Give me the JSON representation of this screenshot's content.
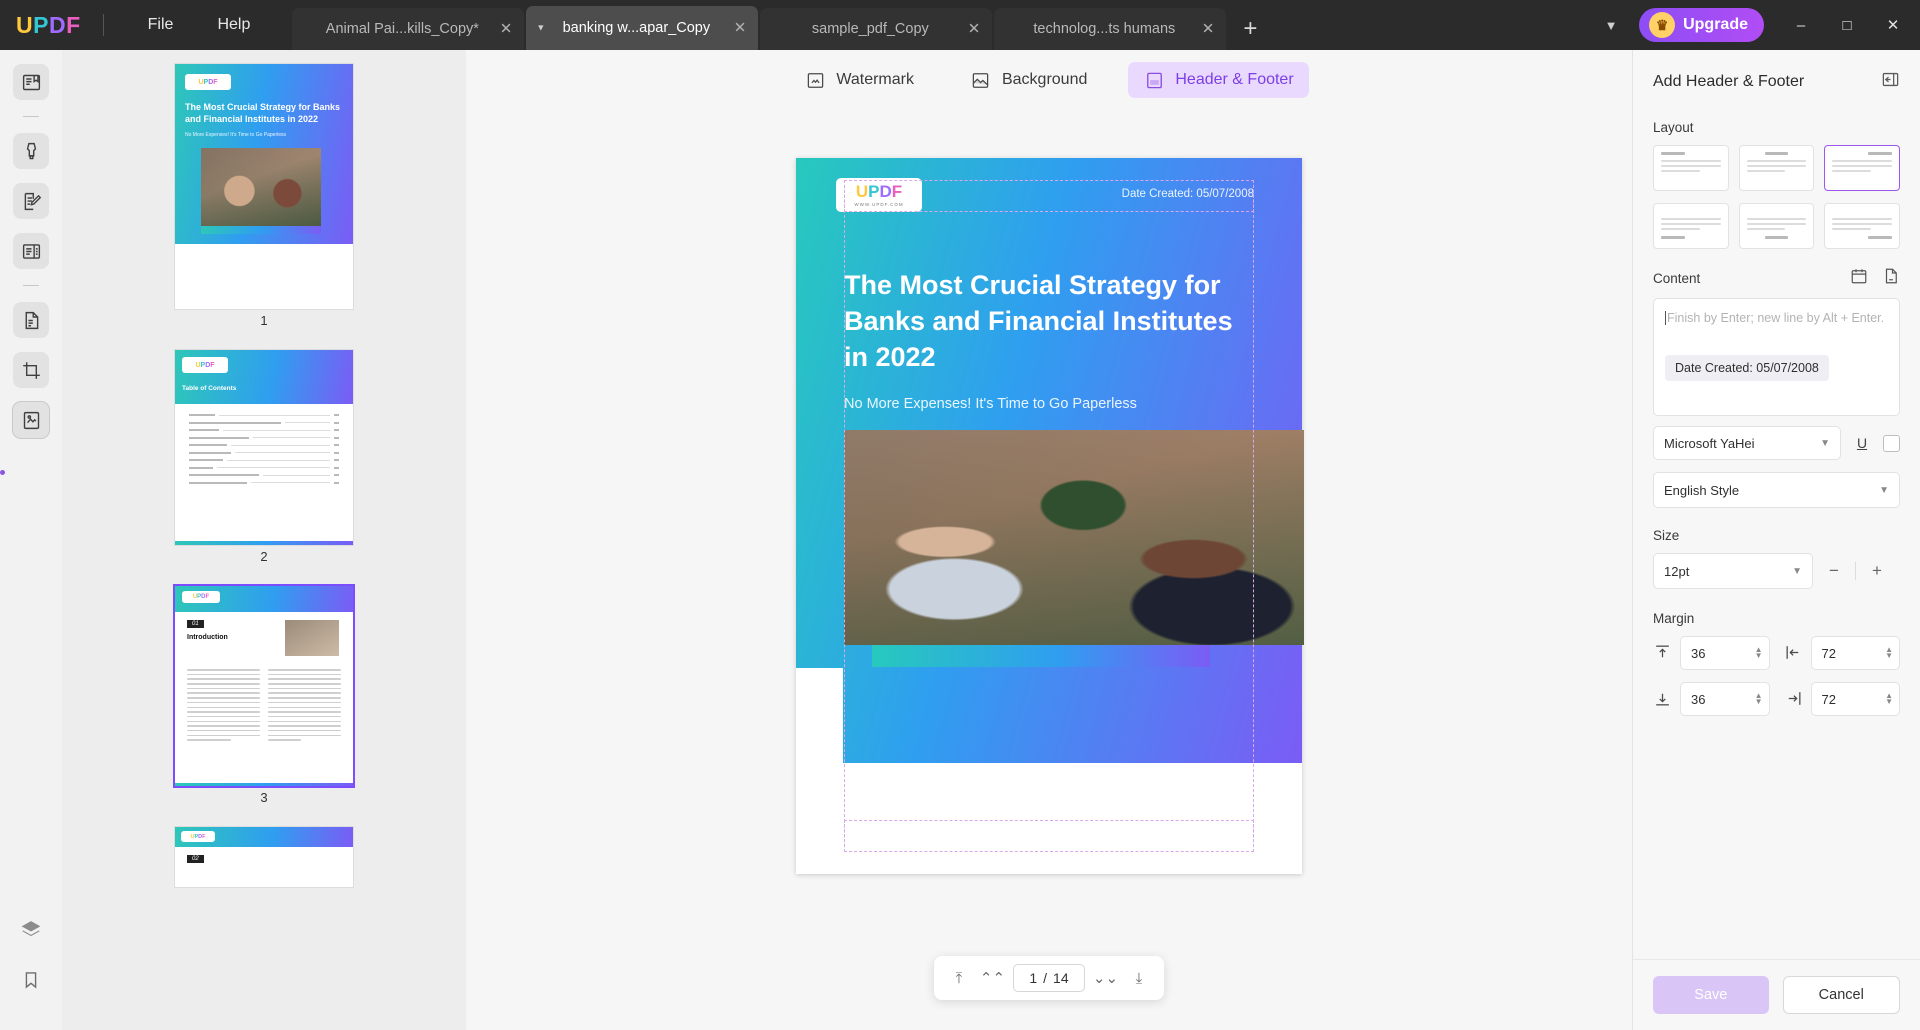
{
  "titlebar": {
    "logo": [
      "U",
      "P",
      "D",
      "F"
    ],
    "menus": [
      {
        "label": "File",
        "name": "menu-file"
      },
      {
        "label": "Help",
        "name": "menu-help"
      }
    ],
    "tabs": [
      {
        "label": "Animal Pai...kills_Copy*",
        "active": false,
        "caret": false
      },
      {
        "label": "banking w...apar_Copy",
        "active": true,
        "caret": true
      },
      {
        "label": "sample_pdf_Copy",
        "active": false,
        "caret": false
      },
      {
        "label": "technolog...ts humans",
        "active": false,
        "caret": false
      }
    ],
    "new_tab": "+",
    "tab_list_caret": "⌄",
    "upgrade_label": "Upgrade",
    "crown": "♛",
    "win_minimize": "—",
    "win_maximize": "❐",
    "win_close": "✕"
  },
  "rail": {
    "items": [
      {
        "name": "sidebar-item-reader",
        "icon": "book-icon",
        "selected": false
      },
      {
        "name": "sidebar-item-annotate",
        "icon": "marker-pen-icon",
        "selected": false
      },
      {
        "name": "sidebar-item-edit-pdf",
        "icon": "edit-document-icon",
        "selected": false
      },
      {
        "name": "sidebar-item-organize",
        "icon": "page-layout-icon",
        "selected": false
      },
      {
        "name": "sidebar-item-convert",
        "icon": "convert-file-icon",
        "selected": false
      },
      {
        "name": "sidebar-item-crop",
        "icon": "crop-icon",
        "selected": false
      },
      {
        "name": "sidebar-item-page-edit",
        "icon": "page-watermark-icon",
        "selected": true
      }
    ],
    "bottom": [
      {
        "name": "sidebar-item-layers",
        "icon": "layers-icon"
      },
      {
        "name": "sidebar-item-bookmarks",
        "icon": "bookmark-icon"
      }
    ]
  },
  "thumbnails": {
    "pages": [
      {
        "number": "1",
        "selected": false,
        "title": "The Most Crucial Strategy for Banks and Financial Institutes in 2022",
        "subtitle": "No More Expenses! It's Time to Go Paperless"
      },
      {
        "number": "2",
        "selected": false,
        "title": "Table of Contents"
      },
      {
        "number": "3",
        "selected": true,
        "badge": "01",
        "title": "Introduction"
      },
      {
        "number": "4",
        "selected": false,
        "badge": "02",
        "title": ""
      }
    ],
    "toc_entries": [
      "Introduction",
      "Increasing Risk Practices and Reducing Development Banks and Financial Firms",
      "Customer Loyalty",
      "Better Customer Servicing and Communication",
      "Electronic Signature",
      "Saving Cost and Time",
      "Enhanced Security",
      "Efficiency",
      "A Good Chance For Developing Nations",
      "Don't worry! The solution is here!"
    ]
  },
  "toolbar": {
    "items": [
      {
        "label": "Watermark",
        "icon": "watermark-icon",
        "active": false
      },
      {
        "label": "Background",
        "icon": "background-icon",
        "active": false
      },
      {
        "label": "Header & Footer",
        "icon": "header-footer-icon",
        "active": true
      }
    ]
  },
  "document": {
    "logo_text": [
      "U",
      "P",
      "D",
      "F"
    ],
    "logo_sub": "WWW.UPDF.COM",
    "date_created": "Date Created: 05/07/2008",
    "title": "The Most Crucial Strategy for Banks and Financial Institutes in 2022",
    "subtitle": "No More Expenses! It's Time to Go Paperless"
  },
  "pagebar": {
    "first": "⤒",
    "prev": "⌃⌃",
    "current": "1",
    "separator": "/",
    "total": "14",
    "next": "⌄⌄",
    "last": "⤓"
  },
  "panel": {
    "title": "Add Header & Footer",
    "expand_icon": "expand-panel-icon",
    "layout_label": "Layout",
    "layout_options": [
      {
        "name": "layout-option-1",
        "selected": false
      },
      {
        "name": "layout-option-2",
        "selected": false
      },
      {
        "name": "layout-option-3",
        "selected": true
      },
      {
        "name": "layout-option-4",
        "selected": false
      },
      {
        "name": "layout-option-5",
        "selected": false
      },
      {
        "name": "layout-option-6",
        "selected": false
      }
    ],
    "content_label": "Content",
    "content_placeholder": "Finish by Enter; new line by Alt + Enter.",
    "content_chip": "Date Created: 05/07/2008",
    "date_icon": "calendar-icon",
    "page_number_icon": "page-number-icon",
    "font_family": "Microsoft YaHei",
    "underline_label": "U",
    "color_swatch": "#ffffff",
    "style_value": "English Style",
    "size_label": "Size",
    "size_value": "12pt",
    "minus": "−",
    "plus": "+",
    "margin_label": "Margin",
    "margins": [
      {
        "name": "margin-top",
        "icon": "margin-top-icon",
        "value": "36"
      },
      {
        "name": "margin-left",
        "icon": "margin-left-icon",
        "value": "72"
      },
      {
        "name": "margin-bottom",
        "icon": "margin-bottom-icon",
        "value": "36"
      },
      {
        "name": "margin-right",
        "icon": "margin-right-icon",
        "value": "72"
      }
    ],
    "save_label": "Save",
    "cancel_label": "Cancel"
  },
  "colors": {
    "accent": "#7b3fe4",
    "accent_soft": "#ead9ff",
    "titlebar": "#2b2b2b",
    "panel_bg": "#f7f7f7"
  }
}
